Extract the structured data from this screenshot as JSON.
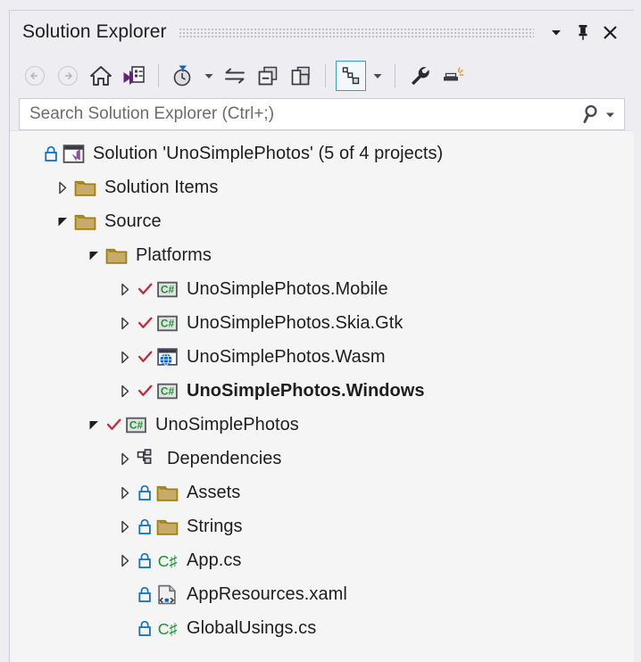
{
  "window": {
    "title": "Solution Explorer",
    "controls": [
      {
        "name": "dropdown-icon",
        "label": "▼"
      },
      {
        "name": "pin-icon",
        "label": "Pin"
      },
      {
        "name": "close-icon",
        "label": "X"
      }
    ]
  },
  "toolbar": {
    "buttons": [
      {
        "name": "back-button",
        "icon": "back-arrow-icon",
        "tooltip": "Back",
        "enabled": false,
        "selected": false
      },
      {
        "name": "forward-button",
        "icon": "forward-arrow-icon",
        "tooltip": "Forward",
        "enabled": false,
        "selected": false
      },
      {
        "name": "home-button",
        "icon": "home-icon",
        "tooltip": "Home",
        "enabled": true,
        "selected": false
      },
      {
        "name": "solution-view-button",
        "icon": "solution-properties-icon",
        "tooltip": "Switch Views",
        "enabled": true,
        "selected": false
      },
      {
        "name": "pending-changes-button",
        "icon": "clock-filter-icon",
        "tooltip": "Pending Changes Filter",
        "enabled": true,
        "selected": false
      },
      {
        "name": "pending-changes-dropdown",
        "icon": "chevron-down-icon",
        "tooltip": "Filter options",
        "enabled": true,
        "selected": false
      },
      {
        "name": "sync-button",
        "icon": "sync-arrows-icon",
        "tooltip": "Sync with Active Document",
        "enabled": true,
        "selected": false
      },
      {
        "name": "collapse-all-button",
        "icon": "collapse-all-icon",
        "tooltip": "Collapse All",
        "enabled": true,
        "selected": false
      },
      {
        "name": "show-all-files-button",
        "icon": "show-all-files-icon",
        "tooltip": "Show All Files",
        "enabled": true,
        "selected": false
      },
      {
        "name": "view-designer-button",
        "icon": "dependency-graph-icon",
        "tooltip": "View Class Diagram",
        "enabled": true,
        "selected": true
      },
      {
        "name": "view-designer-dropdown",
        "icon": "chevron-down-icon",
        "tooltip": "View options",
        "enabled": true,
        "selected": false
      },
      {
        "name": "properties-button",
        "icon": "wrench-icon",
        "tooltip": "Properties",
        "enabled": true,
        "selected": false
      },
      {
        "name": "preview-button",
        "icon": "preview-selected-icon",
        "tooltip": "Preview Selected Items",
        "enabled": true,
        "selected": false
      }
    ]
  },
  "search": {
    "placeholder": "Search Solution Explorer (Ctrl+;)",
    "value": "",
    "icon": "search-icon",
    "dropdown_icon": "chevron-down-icon"
  },
  "tree": {
    "items": [
      {
        "label": "Solution 'UnoSimplePhotos' (5 of 4 projects)",
        "depth": 0,
        "expander": "none",
        "lock": true,
        "check": false,
        "icon": "solution-icon",
        "bold": false
      },
      {
        "label": "Solution Items",
        "depth": 1,
        "expander": "collapsed",
        "lock": false,
        "check": false,
        "icon": "folder-icon",
        "bold": false
      },
      {
        "label": "Source",
        "depth": 1,
        "expander": "expanded",
        "lock": false,
        "check": false,
        "icon": "folder-icon",
        "bold": false
      },
      {
        "label": "Platforms",
        "depth": 2,
        "expander": "expanded",
        "lock": false,
        "check": false,
        "icon": "folder-icon",
        "bold": false
      },
      {
        "label": "UnoSimplePhotos.Mobile",
        "depth": 3,
        "expander": "collapsed",
        "lock": false,
        "check": true,
        "icon": "csharp-project-icon",
        "bold": false
      },
      {
        "label": "UnoSimplePhotos.Skia.Gtk",
        "depth": 3,
        "expander": "collapsed",
        "lock": false,
        "check": true,
        "icon": "csharp-project-icon",
        "bold": false
      },
      {
        "label": "UnoSimplePhotos.Wasm",
        "depth": 3,
        "expander": "collapsed",
        "lock": false,
        "check": true,
        "icon": "wasm-project-icon",
        "bold": false
      },
      {
        "label": "UnoSimplePhotos.Windows",
        "depth": 3,
        "expander": "collapsed",
        "lock": false,
        "check": true,
        "icon": "csharp-project-icon",
        "bold": true
      },
      {
        "label": "UnoSimplePhotos",
        "depth": 2,
        "expander": "expanded",
        "lock": false,
        "check": true,
        "icon": "csharp-project-icon",
        "bold": false
      },
      {
        "label": "Dependencies",
        "depth": 3,
        "expander": "collapsed",
        "lock": false,
        "check": false,
        "icon": "dependencies-icon",
        "bold": false
      },
      {
        "label": "Assets",
        "depth": 3,
        "expander": "collapsed",
        "lock": true,
        "check": false,
        "icon": "folder-icon",
        "bold": false
      },
      {
        "label": "Strings",
        "depth": 3,
        "expander": "collapsed",
        "lock": true,
        "check": false,
        "icon": "folder-icon",
        "bold": false
      },
      {
        "label": "App.cs",
        "depth": 3,
        "expander": "collapsed",
        "lock": true,
        "check": false,
        "icon": "csharp-file-icon",
        "bold": false
      },
      {
        "label": "AppResources.xaml",
        "depth": 3,
        "expander": "none",
        "lock": true,
        "check": false,
        "icon": "xaml-file-icon",
        "bold": false
      },
      {
        "label": "GlobalUsings.cs",
        "depth": 3,
        "expander": "none",
        "lock": true,
        "check": false,
        "icon": "csharp-file-icon",
        "bold": false
      }
    ]
  },
  "colors": {
    "window_background": "#eeeef2",
    "tree_background": "#f5f5f5",
    "text": "#1e1e1e",
    "placeholder_text": "#6d6d6d",
    "folder_fill": "#c8ab67",
    "folder_border": "#9d7f12",
    "lock_blue": "#1271c4",
    "check_red": "#c22b3a",
    "csharp_green": "#17952f",
    "accent_blue": "#3399e6",
    "vs_purple": "#68217a",
    "globe_blue": "#0a64c8"
  }
}
